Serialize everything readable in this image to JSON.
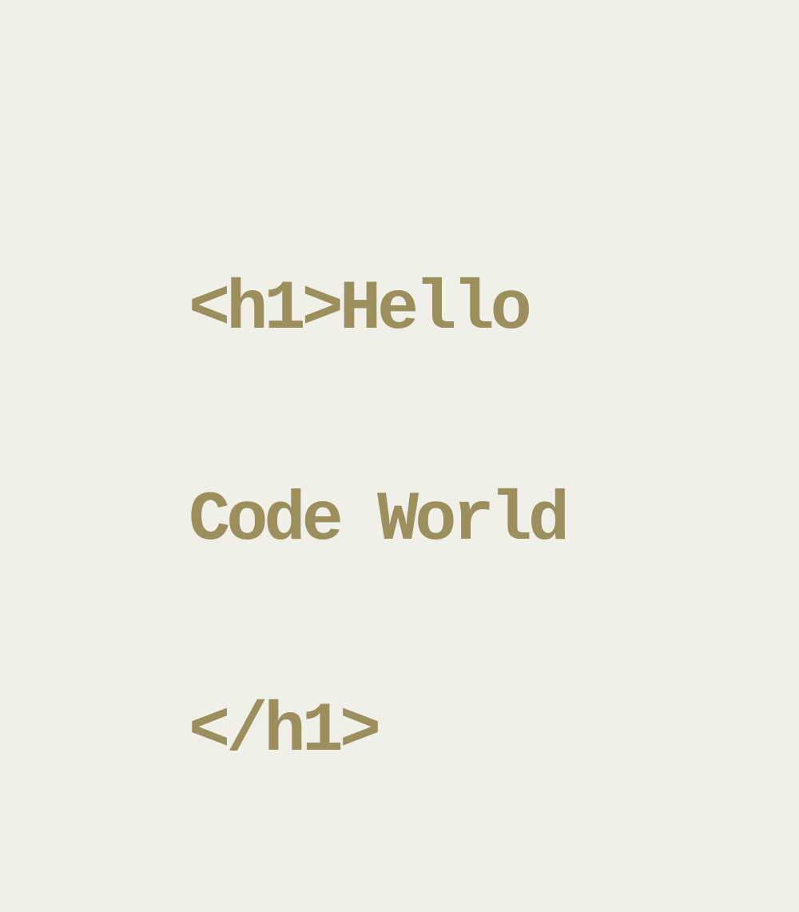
{
  "colors": {
    "background": "#f0efe8",
    "text": "#9c8f5e"
  },
  "code": {
    "lines": [
      "<h1>Hello",
      "Code World",
      "</h1>"
    ]
  }
}
